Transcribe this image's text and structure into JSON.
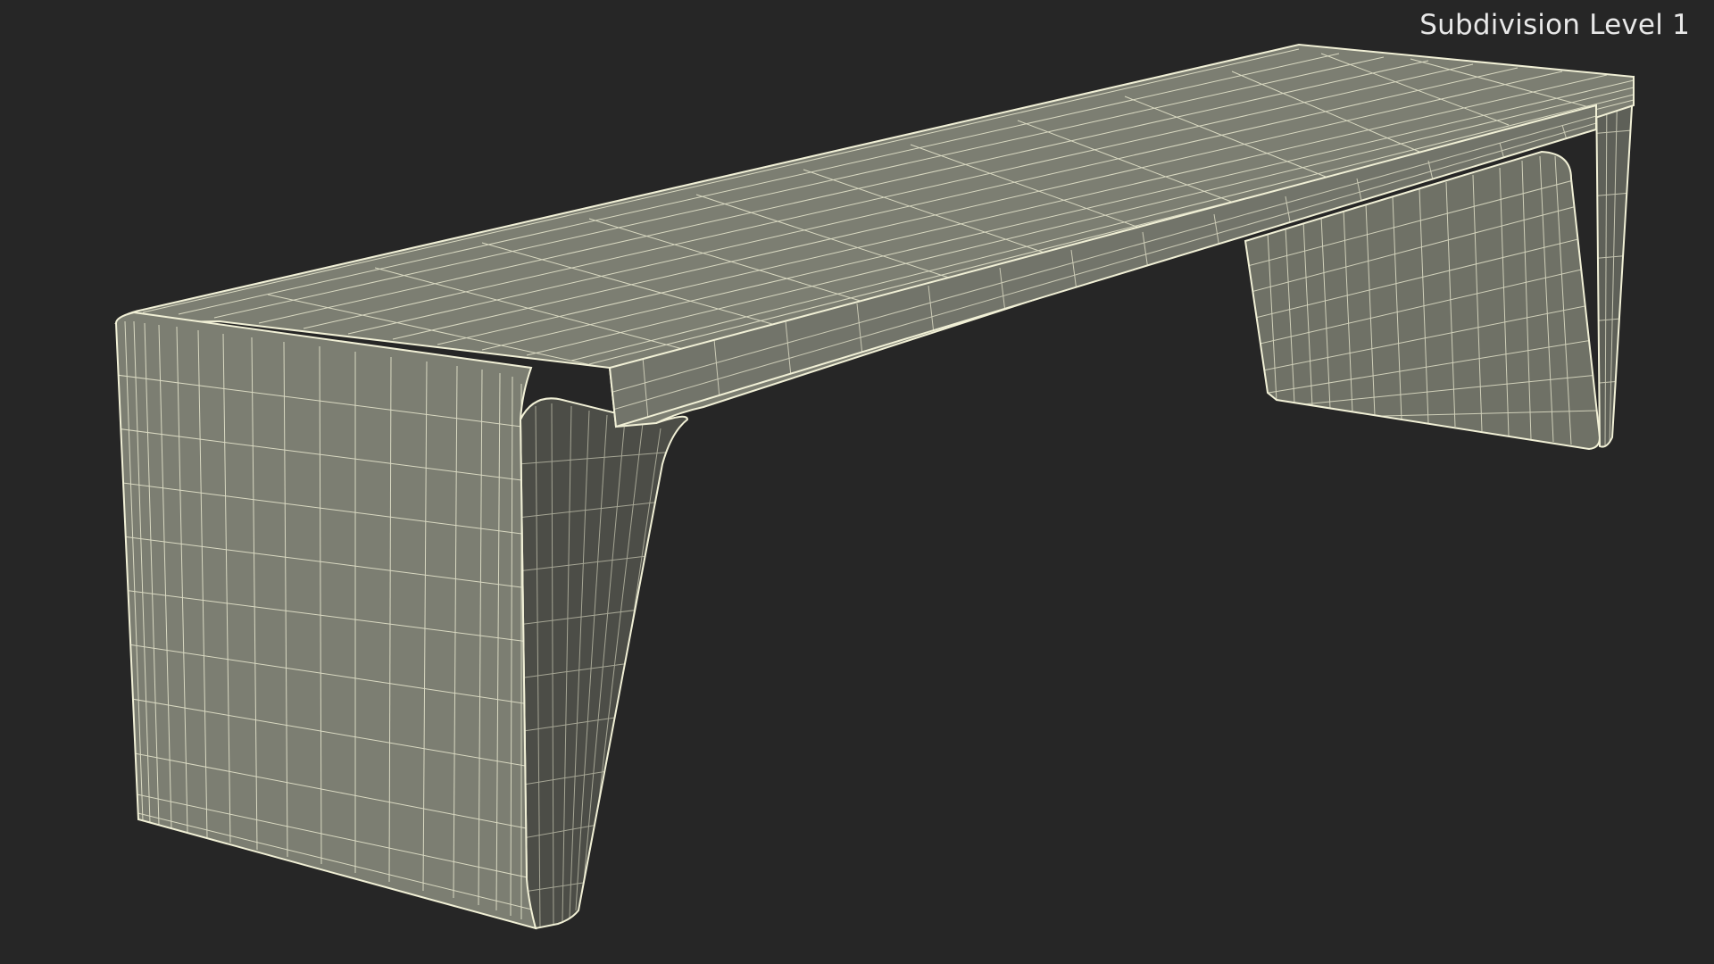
{
  "viewport": {
    "label": "Subdivision Level 1",
    "background": "#262626",
    "surface_color": "#7c7e72",
    "wire_color": "#f1f0d6",
    "model": "bench"
  }
}
